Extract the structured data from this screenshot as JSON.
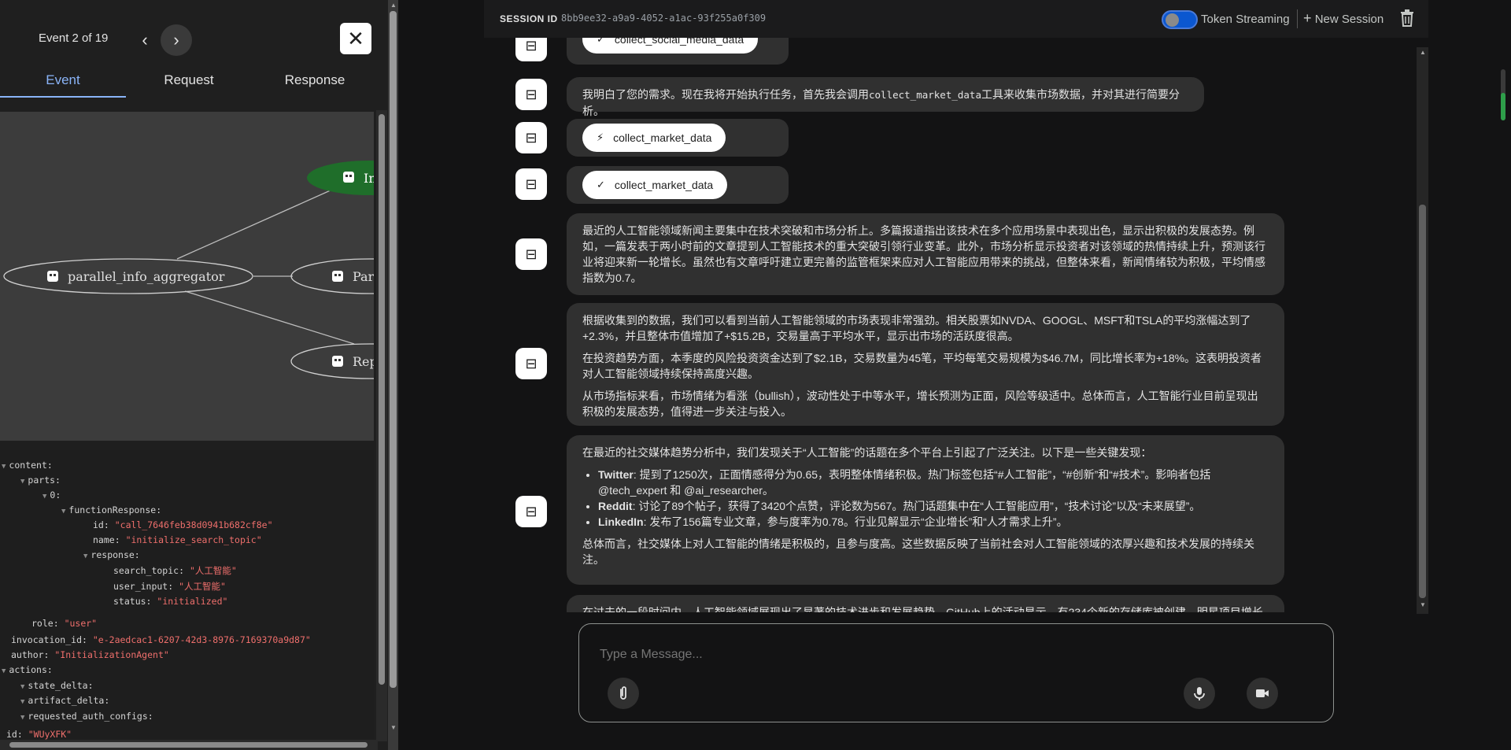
{
  "left_panel": {
    "event_counter": "Event 2 of 19",
    "tabs": [
      {
        "label": "Event",
        "active": true
      },
      {
        "label": "Request",
        "active": false
      },
      {
        "label": "Response",
        "active": false
      }
    ],
    "graph": {
      "nodes": [
        {
          "label": "In",
          "highlighted": true
        },
        {
          "label": "parallel_info_aggregator",
          "highlighted": false
        },
        {
          "label": "Para",
          "highlighted": false
        },
        {
          "label": "Rep",
          "highlighted": false
        }
      ]
    },
    "json": {
      "content_key": "content:",
      "parts_key": "parts:",
      "idx_key": "0:",
      "fr_key": "functionResponse:",
      "id_key": "id:",
      "id_val": "\"call_7646feb38d0941b682cf8e\"",
      "name_key": "name:",
      "name_val": "\"initialize_search_topic\"",
      "response_key": "response:",
      "st_key": "search_topic:",
      "st_val": "\"人工智能\"",
      "ui_key": "user_input:",
      "ui_val": "\"人工智能\"",
      "status_key": "status:",
      "status_val": "\"initialized\"",
      "role_key": "role:",
      "role_val": "\"user\"",
      "inv_key": "invocation_id:",
      "inv_val": "\"e-2aedcac1-6207-42d3-8976-7169370a9d87\"",
      "author_key": "author:",
      "author_val": "\"InitializationAgent\"",
      "actions_key": "actions:",
      "sd_key": "state_delta:",
      "ad_key": "artifact_delta:",
      "rac_key": "requested_auth_configs:",
      "cut_key": "id:",
      "cut_val": "\"WUyXFK\""
    }
  },
  "header": {
    "session_label": "SESSION ID",
    "session_id": "8bb9ee32-a9a9-4052-a1ac-93f255a0f309",
    "token_streaming": "Token Streaming",
    "new_session": "New Session"
  },
  "messages": {
    "chip_top": "collect_social_media_data",
    "msg1_pre": "我明白了您的需求。现在我将开始执行任务，首先我会调用",
    "msg1_code": "collect_market_data",
    "msg1_post": "工具来收集市场数据，并对其进行简要分析。",
    "chip_call": "collect_market_data",
    "chip_done": "collect_market_data",
    "msg2": "最近的人工智能领域新闻主要集中在技术突破和市场分析上。多篇报道指出该技术在多个应用场景中表现出色，显示出积极的发展态势。例如，一篇发表于两小时前的文章提到人工智能技术的重大突破引领行业变革。此外，市场分析显示投资者对该领域的热情持续上升，预测该行业将迎来新一轮增长。虽然也有文章呼吁建立更完善的监管框架来应对人工智能应用带来的挑战，但整体来看，新闻情绪较为积极，平均情感指数为0.7。",
    "msg3_p1": "根据收集到的数据，我们可以看到当前人工智能领域的市场表现非常强劲。相关股票如NVDA、GOOGL、MSFT和TSLA的平均涨幅达到了+2.3%，并且整体市值增加了+$15.2B，交易量高于平均水平，显示出市场的活跃度很高。",
    "msg3_p2": "在投资趋势方面，本季度的风险投资资金达到了$2.1B，交易数量为45笔，平均每笔交易规模为$46.7M，同比增长率为+18%。这表明投资者对人工智能领域持续保持高度兴趣。",
    "msg3_p3": "从市场指标来看，市场情绪为看涨（bullish），波动性处于中等水平，增长预测为正面，风险等级适中。总体而言，人工智能行业目前呈现出积极的发展态势，值得进一步关注与投入。",
    "msg4_intro": "在最近的社交媒体趋势分析中，我们发现关于“人工智能”的话题在多个平台上引起了广泛关注。以下是一些关键发现：",
    "msg4_items": [
      {
        "platform": "Twitter",
        "text": ": 提到了1250次，正面情感得分为0.65，表明整体情绪积极。热门标签包括“#人工智能”，“#创新”和“#技术”。影响者包括@tech_expert 和 @ai_researcher。"
      },
      {
        "platform": "Reddit",
        "text": ": 讨论了89个帖子，获得了3420个点赞，评论数为567。热门话题集中在“人工智能应用”，“技术讨论”以及“未来展望”。"
      },
      {
        "platform": "LinkedIn",
        "text": ": 发布了156篇专业文章，参与度率为0.78。行业见解显示“企业增长”和“人才需求上升”。"
      }
    ],
    "msg4_outro": "总体而言，社交媒体上对人工智能的情绪是积极的，且参与度高。这些数据反映了当前社会对人工智能领域的浓厚兴趣和技术发展的持续关注。",
    "msg5": "在过去的一段时间内，人工智能领域展现出了显著的技术进步和发展趋势。GitHub上的活动显示，有234个新的存储库被创建，明星项目增长"
  },
  "input": {
    "placeholder": "Type a Message..."
  }
}
